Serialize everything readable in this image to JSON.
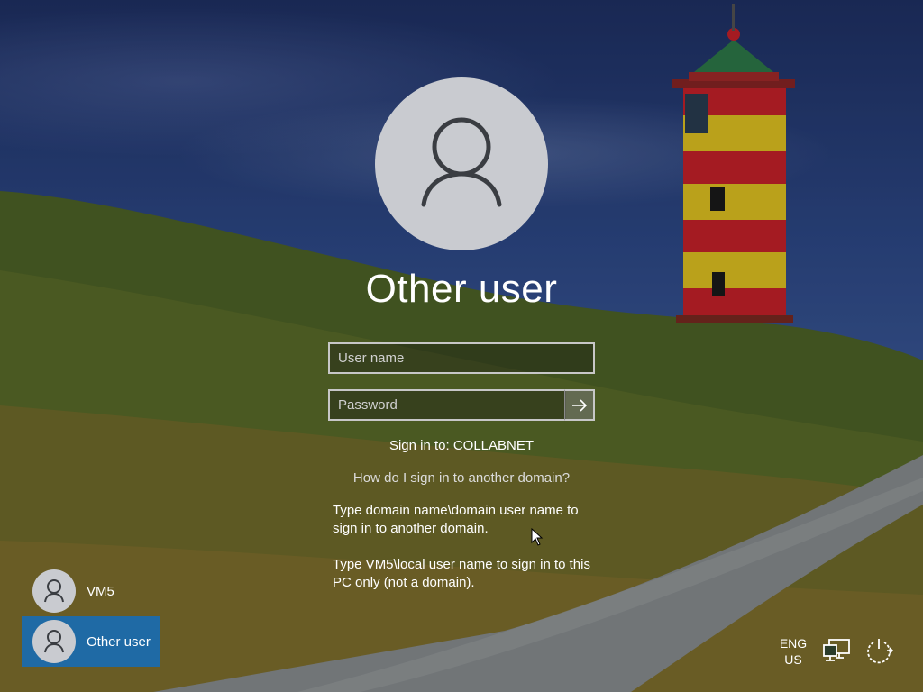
{
  "login": {
    "title": "Other user",
    "username_placeholder": "User name",
    "password_placeholder": "Password",
    "signin_to": "Sign in to: COLLABNET",
    "help_link": "How do I sign in to another domain?",
    "help_text_1": "Type domain name\\domain user name to sign in to another domain.",
    "help_text_2": "Type VM5\\local user name to sign in to this PC only (not a domain)."
  },
  "users": [
    {
      "name": "VM5",
      "selected": false
    },
    {
      "name": "Other user",
      "selected": true
    }
  ],
  "status": {
    "language_line1": "ENG",
    "language_line2": "US"
  },
  "icons": {
    "avatar": "user-icon",
    "submit": "arrow-right-icon",
    "network": "network-icon",
    "power": "power-icon"
  }
}
